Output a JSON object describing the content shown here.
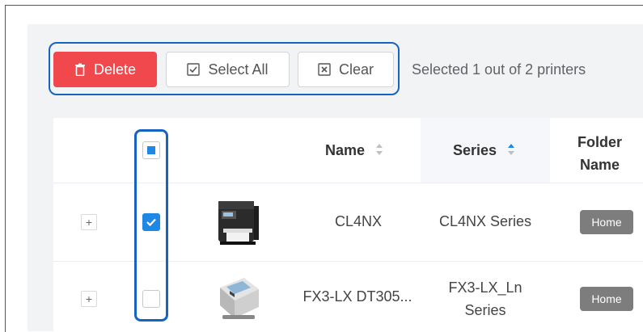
{
  "toolbar": {
    "delete_label": "Delete",
    "select_all_label": "Select All",
    "clear_label": "Clear",
    "selection_status": "Selected 1 out of 2 printers"
  },
  "table": {
    "columns": {
      "name": "Name",
      "series": "Series",
      "folder_line1": "Folder",
      "folder_line2": "Name"
    },
    "rows": [
      {
        "expand": "+",
        "checked": true,
        "name": "CL4NX",
        "series": "CL4NX Series",
        "folder": "Home"
      },
      {
        "expand": "+",
        "checked": false,
        "name": "FX3-LX DT305...",
        "series_line1": "FX3-LX_Ln",
        "series_line2": "Series",
        "folder": "Home"
      }
    ]
  },
  "colors": {
    "delete_bg": "#f0484c",
    "accent": "#1e88e5",
    "highlight_border": "#1565c0",
    "badge_bg": "#7d7d7d"
  },
  "icons": {
    "delete": "trash-icon",
    "select_all": "checkbox-icon",
    "clear": "x-box-icon",
    "sort": "sort-icon"
  }
}
